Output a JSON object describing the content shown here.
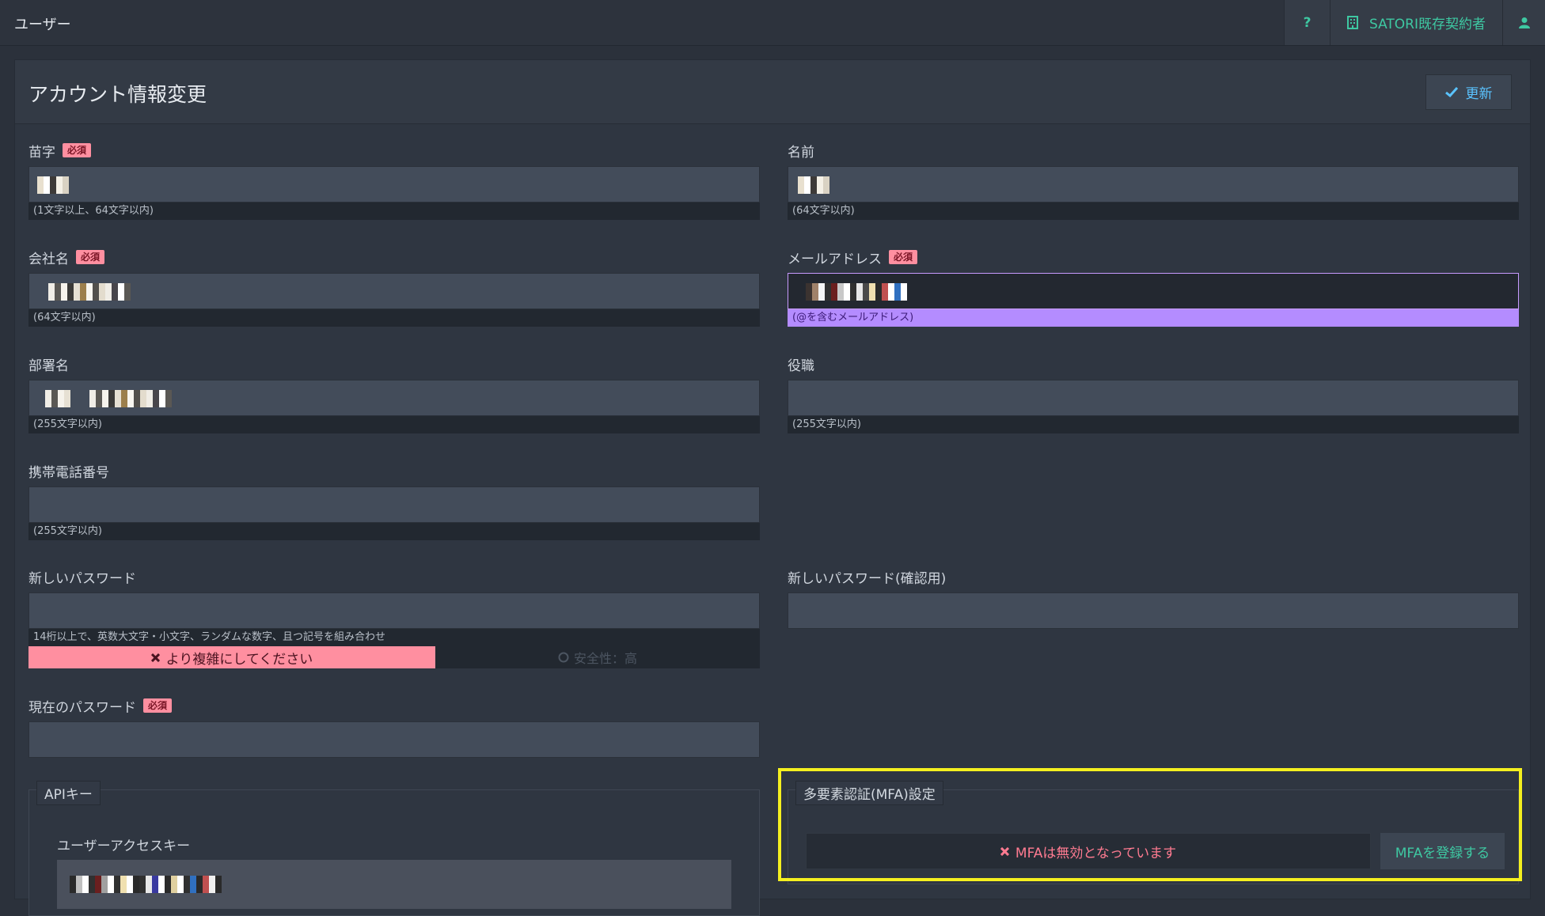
{
  "topbar": {
    "title": "ユーザー",
    "help_label": "?",
    "contract_label": "SATORI既存契約者",
    "icons": {
      "contract": "building-icon",
      "user": "user-icon"
    }
  },
  "panel": {
    "heading": "アカウント情報変更",
    "update_label": "更新"
  },
  "fields": {
    "last_name": {
      "label": "苗字",
      "required": "必須",
      "hint": "(1文字以上、64文字以内)"
    },
    "first_name": {
      "label": "名前",
      "hint": "(64文字以内)"
    },
    "company": {
      "label": "会社名",
      "required": "必須",
      "hint": "(64文字以内)"
    },
    "email": {
      "label": "メールアドレス",
      "required": "必須",
      "hint": "(@を含むメールアドレス)"
    },
    "department": {
      "label": "部署名",
      "hint": "(255文字以内)"
    },
    "position": {
      "label": "役職",
      "hint": "(255文字以内)"
    },
    "mobile": {
      "label": "携帯電話番号",
      "hint": "(255文字以内)"
    },
    "new_password": {
      "label": "新しいパスワード",
      "hint": "14桁以上で、英数大文字・小文字、ランダムな数字、且つ記号を組み合わせ",
      "strength_bad": "より複雑にしてください",
      "strength_good": "安全性：高"
    },
    "new_password_confirm": {
      "label": "新しいパスワード(確認用)"
    },
    "current_password": {
      "label": "現在のパスワード",
      "required": "必須"
    }
  },
  "api": {
    "legend": "APIキー",
    "access_key_label": "ユーザーアクセスキー"
  },
  "mfa": {
    "legend": "多要素認証(MFA)設定",
    "status": "MFAは無効となっています",
    "register_label": "MFAを登録する"
  },
  "colors": {
    "accent_green": "#3ec8a2",
    "accent_blue": "#5ac3ff",
    "required_pink": "#ff8fa0",
    "focus_purple": "#c89bff",
    "highlight_yellow": "#f5f01f"
  }
}
